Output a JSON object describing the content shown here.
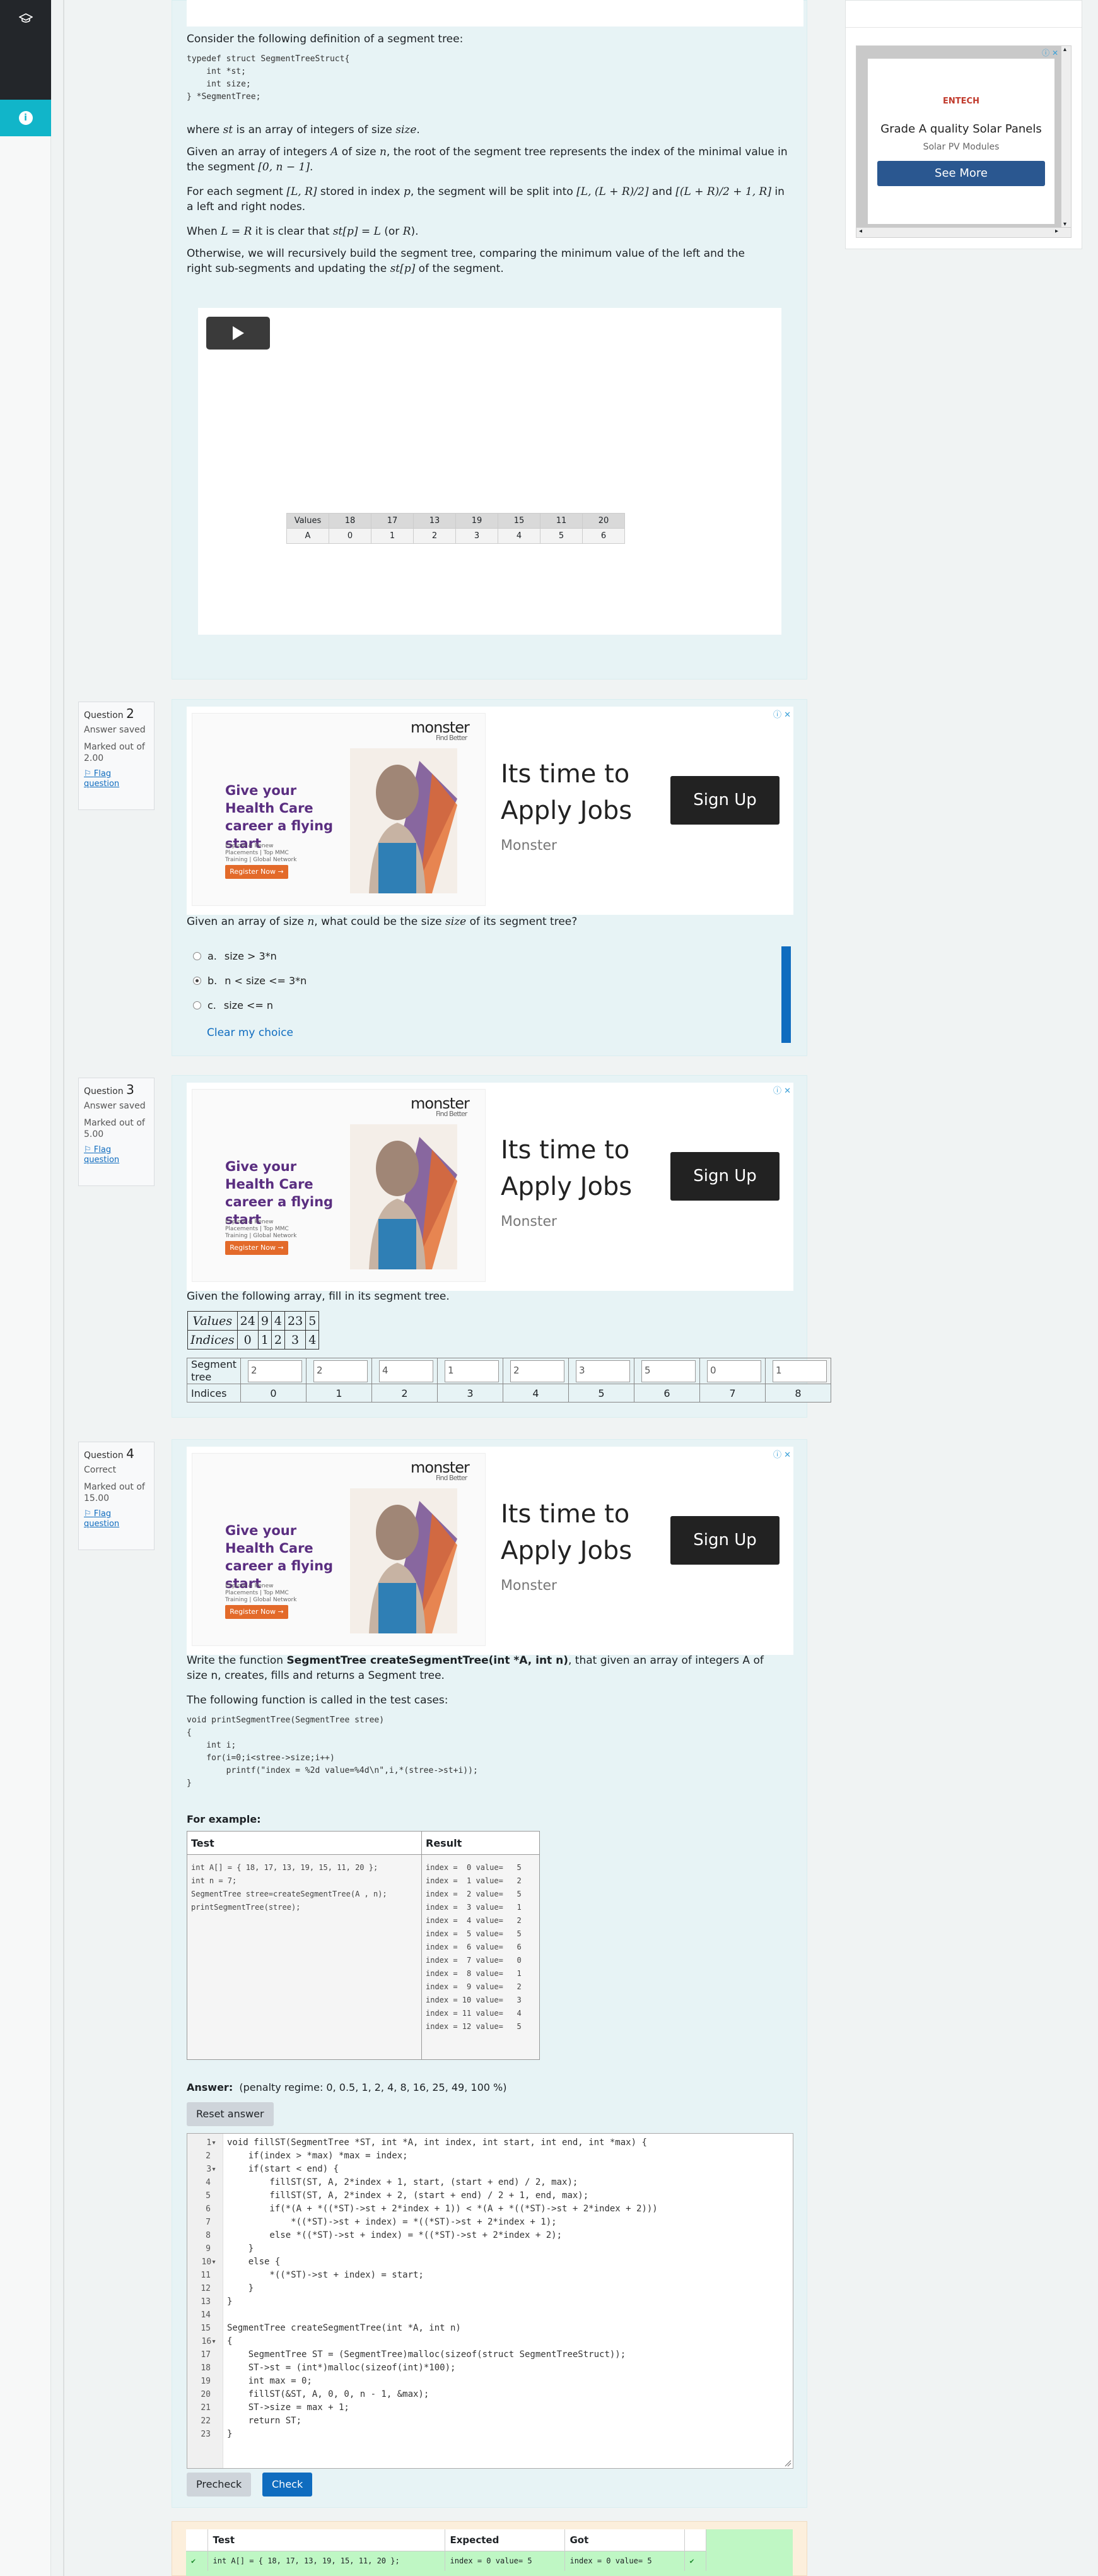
{
  "sidebar": {
    "top_icon": "graduation-cap-icon",
    "info_icon": "info-icon",
    "info_glyph": "i"
  },
  "ad_right": {
    "logo": "ENTECH",
    "headline": "Grade A quality Solar Panels",
    "sub": "Solar PV Modules",
    "button": "See More",
    "adchoices": "ⓘ ✕",
    "scroll_left": "◂",
    "scroll_right": "▸",
    "scroll_up": "▴",
    "scroll_down": "▾"
  },
  "q1": {
    "intro": "Consider the following definition of a segment tree:",
    "code": "typedef struct SegmentTreeStruct{\n    int *st;\n    int size;\n} *SegmentTree;",
    "lines": [
      "where st is an array of integers of size size.",
      "Given an array of integers A of size n, the root of the segment tree represents the index of the minimal value in the segment [0, n − 1].",
      "For each segment [L, R] stored in index p, the segment will be split into [L, (L + R)/2] and [(L + R)/2 + 1, R] in a left and right nodes.",
      "When L = R it is clear that st[p] = L (or R).",
      "Otherwise, we will recursively build the segment tree, comparing the minimum value of the left and the right sub-segments and updating the st[p] of the segment."
    ],
    "video_table": {
      "rows": [
        [
          "Values",
          "18",
          "17",
          "13",
          "19",
          "15",
          "11",
          "20"
        ],
        [
          "A",
          "0",
          "1",
          "2",
          "3",
          "4",
          "5",
          "6"
        ]
      ]
    }
  },
  "ad_monster": {
    "logo": "monster",
    "tagline": "Find Better",
    "headline": "Give your Health Care career a flying start",
    "small": "Explore & Renew Placements | Top MMC Training | Global Network",
    "register": "Register Now →",
    "title": "Its time to Apply Jobs",
    "source": "Monster",
    "button": "Sign Up",
    "adchoices": "ⓘ ✕"
  },
  "q2": {
    "info": {
      "label": "Question",
      "num": "2",
      "status": "Answer saved",
      "marked": "Marked out of 2.00",
      "flag": "Flag question"
    },
    "prompt": "Given an array of size n, what could be the size size of its segment tree?",
    "options": [
      {
        "letter": "a.",
        "text": "size > 3*n",
        "selected": false
      },
      {
        "letter": "b.",
        "text": "n < size <= 3*n",
        "selected": true
      },
      {
        "letter": "c.",
        "text": "size <= n",
        "selected": false
      }
    ],
    "clear": "Clear my choice"
  },
  "q3": {
    "info": {
      "label": "Question",
      "num": "3",
      "status": "Answer saved",
      "marked": "Marked out of 5.00",
      "flag": "Flag question"
    },
    "prompt": "Given the following array, fill in its segment tree.",
    "mtable": {
      "labels": [
        "Values",
        "Indices"
      ],
      "values": [
        "24",
        "9",
        "4",
        "23",
        "5"
      ],
      "indices": [
        "0",
        "1",
        "2",
        "3",
        "4"
      ]
    },
    "seg_label": "Segment tree",
    "seg_values": [
      "2",
      "2",
      "4",
      "1",
      "2",
      "3",
      "5",
      "0",
      "1"
    ],
    "idx_label": "Indices",
    "seg_indices": [
      "0",
      "1",
      "2",
      "3",
      "4",
      "5",
      "6",
      "7",
      "8"
    ]
  },
  "q4": {
    "info": {
      "label": "Question",
      "num": "4",
      "status": "Correct",
      "marked": "Marked out of 15.00",
      "flag": "Flag question"
    },
    "prompt_pre": "Write the function ",
    "prompt_bold": "SegmentTree createSegmentTree(int *A, int n)",
    "prompt_post": ", that given an array of integers A of size n, creates, fills and returns a Segment tree.",
    "called": "The following function is called in the test cases:",
    "code": "void printSegmentTree(SegmentTree stree)\n{\n    int i;\n    for(i=0;i<stree->size;i++)\n        printf(\"index = %2d value=%4d\\n\",i,*(stree->st+i));\n}",
    "for_example": "For example:",
    "ex_headers": [
      "Test",
      "Result"
    ],
    "ex_test": "int A[] = { 18, 17, 13, 19, 15, 11, 20 };\nint n = 7;\nSegmentTree stree=createSegmentTree(A , n);\nprintSegmentTree(stree);",
    "ex_result": "index =  0 value=   5\nindex =  1 value=   2\nindex =  2 value=   5\nindex =  3 value=   1\nindex =  4 value=   2\nindex =  5 value=   5\nindex =  6 value=   6\nindex =  7 value=   0\nindex =  8 value=   1\nindex =  9 value=   2\nindex = 10 value=   3\nindex = 11 value=   4\nindex = 12 value=   5",
    "answer_label": "Answer:",
    "penalty": "(penalty regime: 0, 0.5, 1, 2, 4, 8, 16, 25, 49, 100 %)",
    "reset": "Reset answer",
    "code_lines": [
      "void fillST(SegmentTree *ST, int *A, int index, int start, int end, int *max) {",
      "    if(index > *max) *max = index;",
      "    if(start < end) {",
      "        fillST(ST, A, 2*index + 1, start, (start + end) / 2, max);",
      "        fillST(ST, A, 2*index + 2, (start + end) / 2 + 1, end, max);",
      "        if(*(A + *((*ST)->st + 2*index + 1)) < *(A + *((*ST)->st + 2*index + 2)))",
      "            *((*ST)->st + index) = *((*ST)->st + 2*index + 1);",
      "        else *((*ST)->st + index) = *((*ST)->st + 2*index + 2);",
      "    }",
      "    else {",
      "        *((*ST)->st + index) = start;",
      "    }",
      "}",
      "",
      "SegmentTree createSegmentTree(int *A, int n)",
      "{",
      "    SegmentTree ST = (SegmentTree)malloc(sizeof(struct SegmentTreeStruct));",
      "    ST->st = (int*)malloc(sizeof(int)*100);",
      "    int max = 0;",
      "    fillST(&ST, A, 0, 0, n - 1, &max);",
      "    ST->size = max + 1;",
      "    return ST;",
      "}"
    ],
    "fold_lines": [
      1,
      3,
      10,
      16
    ],
    "precheck": "Precheck",
    "check": "Check",
    "res_headers": [
      "",
      "Test",
      "Expected",
      "Got",
      ""
    ],
    "res_row": [
      "✔",
      "int A[] = { 18, 17, 13, 19, 15, 11, 20 };",
      "index =  0 value=   5",
      "index =  0 value=   5",
      "✔"
    ]
  }
}
